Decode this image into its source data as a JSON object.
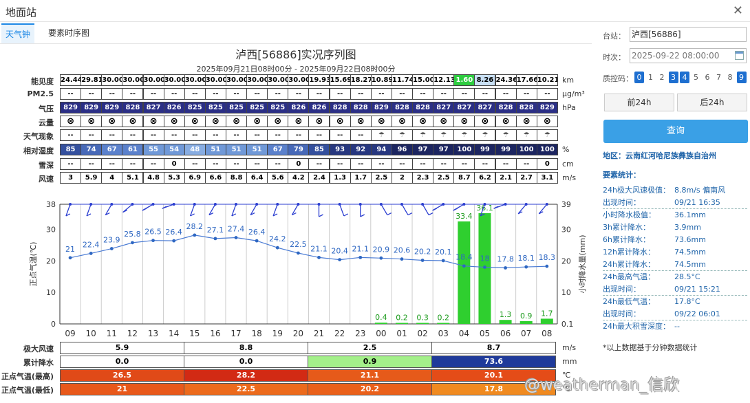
{
  "window": {
    "title": "地面站",
    "close": "✕"
  },
  "tabs": [
    {
      "label": "天气钟"
    },
    {
      "label": "要素时序图"
    }
  ],
  "chart_header": {
    "title": "泸西[56886]实况序列图",
    "subtitle": "2025年09月21日08时00分 - 2025年09月22日08时00分"
  },
  "colors": {
    "accent": "#1e88e5",
    "button": "#3aa0e6",
    "series": "#2e67c2",
    "precip": "#2fcf2f",
    "wind": "#2b3ed0"
  },
  "rows": [
    {
      "label": "能见度",
      "unit": "km",
      "values": [
        "24.44",
        "29.81",
        "30.00",
        "30.00",
        "30.00",
        "30.00",
        "30.00",
        "30.00",
        "30.00",
        "30.00",
        "30.00",
        "30.00",
        "19.93",
        "15.69",
        "18.27",
        "10.89",
        "11.74",
        "15.00",
        "12.13",
        "1.60",
        "8.26",
        "24.36",
        "17.66",
        "10.21"
      ]
    },
    {
      "label": "PM2.5",
      "unit": "μg/m³",
      "values": [
        "--",
        "--",
        "--",
        "--",
        "--",
        "--",
        "--",
        "--",
        "--",
        "--",
        "--",
        "--",
        "--",
        "--",
        "--",
        "--",
        "--",
        "--",
        "--",
        "--",
        "--",
        "--",
        "--",
        "--"
      ]
    },
    {
      "label": "气压",
      "unit": "hPa",
      "values": [
        "829",
        "829",
        "829",
        "828",
        "827",
        "826",
        "825",
        "825",
        "825",
        "825",
        "825",
        "826",
        "826",
        "828",
        "828",
        "829",
        "828",
        "828",
        "827",
        "827",
        "827",
        "828",
        "828",
        "829"
      ]
    },
    {
      "label": "云量",
      "unit": "",
      "values": [
        "⊗",
        "⊗",
        "⊗",
        "⊗",
        "⊗",
        "⊗",
        "⊗",
        "⊗",
        "⊗",
        "⊗",
        "⊗",
        "⊗",
        "⊗",
        "⊗",
        "⊗",
        "⊗",
        "⊗",
        "⊗",
        "⊗",
        "⊗",
        "⊗",
        "⊗",
        "⊗",
        "⊗"
      ]
    },
    {
      "label": "天气现象",
      "unit": "",
      "values": [
        "--",
        "--",
        "--",
        "--",
        "--",
        "--",
        "--",
        "--",
        "--",
        "--",
        "--",
        "--",
        "--",
        "--",
        "--",
        "☂",
        "☂",
        "☂",
        "☂",
        "☂",
        "☂",
        "☂",
        "☂",
        "☂"
      ]
    },
    {
      "label": "相对湿度",
      "unit": "%",
      "values": [
        "85",
        "74",
        "67",
        "61",
        "55",
        "54",
        "48",
        "51",
        "51",
        "51",
        "67",
        "79",
        "85",
        "93",
        "92",
        "94",
        "96",
        "97",
        "97",
        "100",
        "99",
        "99",
        "100",
        "100"
      ]
    },
    {
      "label": "雪深",
      "unit": "cm",
      "values": [
        "--",
        "--",
        "--",
        "--",
        "--",
        "0",
        "--",
        "--",
        "--",
        "--",
        "--",
        "0",
        "--",
        "--",
        "--",
        "--",
        "--",
        "--",
        "--",
        "--",
        "--",
        "--",
        "--",
        "0"
      ]
    },
    {
      "label": "风速",
      "unit": "m/s",
      "values": [
        "3",
        "5.9",
        "4",
        "5.1",
        "4.8",
        "5.3",
        "6.9",
        "6.6",
        "8.8",
        "6.4",
        "5.6",
        "4.2",
        "2.4",
        "1.3",
        "1.7",
        "2.5",
        "2",
        "2.3",
        "2.5",
        "8.7",
        "6.2",
        "2.1",
        "2.7",
        "3.1"
      ]
    }
  ],
  "chart_data": {
    "type": "line",
    "hours": [
      "09",
      "10",
      "11",
      "12",
      "13",
      "14",
      "15",
      "16",
      "17",
      "18",
      "19",
      "20",
      "21",
      "22",
      "23",
      "00",
      "01",
      "02",
      "03",
      "04",
      "05",
      "06",
      "07",
      "08"
    ],
    "ylabel": "正点气温(℃)",
    "y2label": "小时降水量(mm)",
    "yticks": [
      "38",
      "30",
      "20",
      "10",
      "0"
    ],
    "y2ticks": [
      "39",
      "30",
      "20",
      "10",
      "0.1"
    ],
    "ylim": [
      0,
      38
    ],
    "series": [
      {
        "values": [
          21,
          22.4,
          23.9,
          25.8,
          26.5,
          26.4,
          28.2,
          27.1,
          27.4,
          26.4,
          24.2,
          22.5,
          21.1,
          20.4,
          21.1,
          20.9,
          20.6,
          20.2,
          20.1,
          18.4,
          18,
          17.8,
          18.1,
          18.3
        ],
        "labels": [
          "21",
          "22.4",
          "23.9",
          "25.8",
          "26.5",
          "26.4",
          "28.2",
          "27.1",
          "27.4",
          "26.4",
          "24.2",
          "22.5",
          "21.1",
          "20.4",
          "21.1",
          "20.9",
          "20.6",
          "20.2",
          "20.1",
          "18.4",
          "18",
          "17.8",
          "18.1",
          "18.3"
        ]
      },
      {
        "type": "bar",
        "values": [
          0,
          0,
          0,
          0,
          0,
          0,
          0,
          0,
          0,
          0,
          0,
          0,
          0,
          0,
          0,
          0.4,
          0.2,
          0.3,
          0.2,
          33.4,
          36.1,
          1.3,
          0.9,
          1.7
        ],
        "labels": [
          "",
          "",
          "",
          "",
          "",
          "",
          "",
          "",
          "",
          "",
          "",
          "",
          "",
          "",
          "",
          "0.4",
          "0.2",
          "0.3",
          "0.2",
          "33.4",
          "36.1",
          "1.3",
          "0.9",
          "1.7"
        ]
      }
    ],
    "wind_direction_deg": [
      200,
      200,
      210,
      230,
      240,
      250,
      200,
      210,
      200,
      210,
      200,
      210,
      180,
      160,
      180,
      150,
      150,
      150,
      300,
      300,
      340,
      250,
      320,
      320
    ]
  },
  "bottom": [
    {
      "label": "极大风速",
      "unit": "m/s",
      "values": [
        "5.9",
        "8.8",
        "2.5",
        "8.7"
      ]
    },
    {
      "label": "累计降水",
      "unit": "mm",
      "values": [
        "0.0",
        "0.0",
        "0.9",
        "73.6"
      ]
    },
    {
      "label": "正点气温(最高)",
      "unit": "℃",
      "values": [
        "26.5",
        "28.2",
        "21.1",
        "20.1"
      ]
    },
    {
      "label": "正点气温(最低)",
      "unit": "℃",
      "values": [
        "21",
        "22.5",
        "20.2",
        "17.8"
      ]
    }
  ],
  "sidebar": {
    "station_label": "台站：",
    "station_value": "泸西[56886]",
    "time_label": "时次：",
    "time_value": "2025-09-22 08:00:00",
    "qc_label": "质控码：",
    "qc_codes": [
      "0",
      "1",
      "2",
      "3",
      "4",
      "5",
      "6",
      "7",
      "8",
      "9"
    ],
    "prev_button": "前24h",
    "next_button": "后24h",
    "query_button": "查询",
    "region": "地区：云南红河哈尼族彝族自治州",
    "stats_title": "要素统计：",
    "stats": [
      {
        "k": "24h极大风速极值：",
        "v": "8.8m/s 偏南风"
      },
      {
        "k": "出现时间：",
        "v": "09/21 16:35"
      },
      {
        "k": "小时降水极值：",
        "v": "36.1mm"
      },
      {
        "k": "3h累计降水：",
        "v": "3.9mm"
      },
      {
        "k": "6h累计降水：",
        "v": "73.6mm"
      },
      {
        "k": "12h累计降水：",
        "v": "74.5mm"
      },
      {
        "k": "24h累计降水：",
        "v": "74.5mm"
      },
      {
        "k": "24h最高气温：",
        "v": "28.5°C"
      },
      {
        "k": "出现时间：",
        "v": "09/21 15:21"
      },
      {
        "k": "24h最低气温：",
        "v": "17.8°C"
      },
      {
        "k": "出现时间：",
        "v": "09/22 06:01"
      },
      {
        "k": "24h最大积雪深度：",
        "v": "--"
      }
    ],
    "note": "*以上数据基于分钟数据统计"
  },
  "watermark": "@weatherman_信欣"
}
